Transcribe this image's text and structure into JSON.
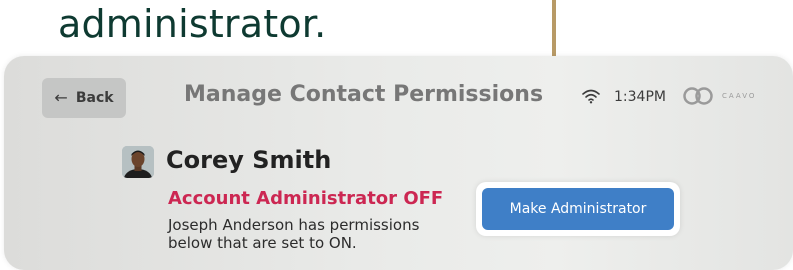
{
  "caption": "administrator.",
  "header": {
    "back_label": "Back",
    "back_icon": "arrow-left-icon",
    "title": "Manage Contact Permissions",
    "time": "1:34PM",
    "logo_text": "CAAVO"
  },
  "contact": {
    "name": "Corey Smith",
    "admin_status": "Account Administrator  OFF",
    "description": "Joseph Anderson has permissions below that are set to ON."
  },
  "actions": {
    "make_admin_label": "Make Administrator"
  },
  "colors": {
    "caption": "#0e3a31",
    "arrow": "#b89a66",
    "status_off": "#cc2752",
    "primary_button": "#3f7fc7"
  }
}
